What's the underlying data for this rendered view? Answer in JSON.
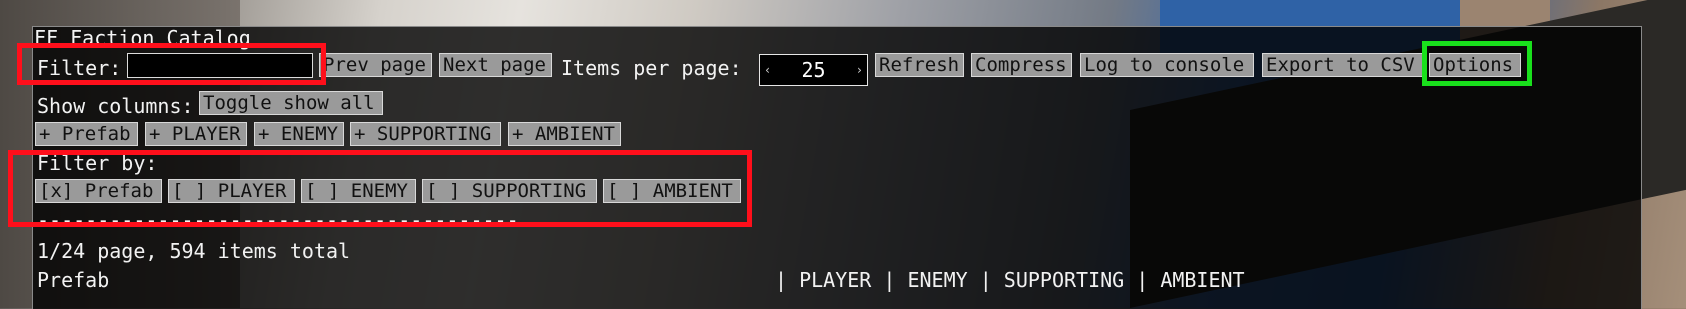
{
  "window": {
    "title": "FF Faction Catalog"
  },
  "toolbar": {
    "filter_label": "Filter:",
    "filter_value": "",
    "prev_page": "Prev page",
    "next_page": "Next page",
    "items_per_page_label": "Items per page:",
    "items_per_page_value": "25",
    "refresh": "Refresh",
    "compress": "Compress",
    "log_to_console": "Log to console",
    "export_to_csv": "Export to CSV",
    "options": "Options"
  },
  "columns": {
    "label": "Show columns:",
    "toggle_all": "Toggle show all",
    "items": [
      "+ Prefab",
      "+ PLAYER",
      "+ ENEMY",
      "+ SUPPORTING",
      "+ AMBIENT"
    ]
  },
  "filter_by": {
    "label": "Filter by:",
    "items": [
      "[x] Prefab",
      "[ ] PLAYER",
      "[ ] ENEMY",
      "[ ] SUPPORTING",
      "[ ] AMBIENT"
    ],
    "separator": "----------------------------------------"
  },
  "status": {
    "summary": "1/24 page, 594 items total"
  },
  "table": {
    "header_left": "Prefab",
    "header_right": "| PLAYER | ENEMY | SUPPORTING | AMBIENT"
  },
  "highlights": {
    "red": "#ff0f1b",
    "green": "#19e01c"
  }
}
